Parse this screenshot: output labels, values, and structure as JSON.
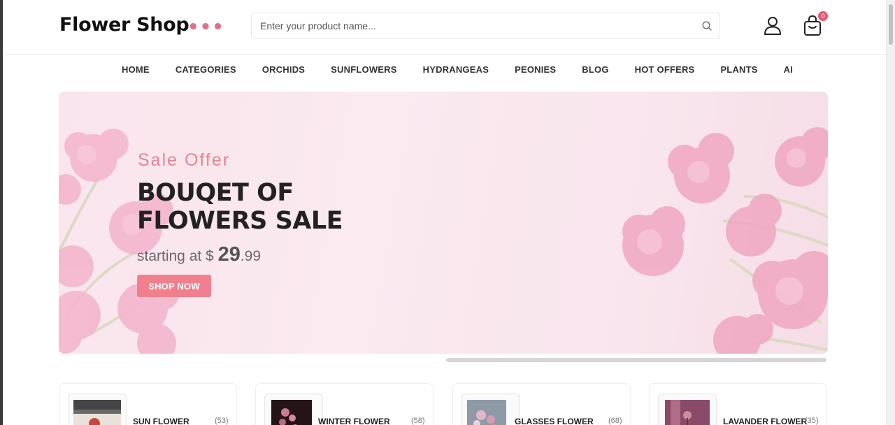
{
  "header": {
    "logo_text": "Flower Shop",
    "logo_dots": "•••",
    "search_placeholder": "Enter your product name...",
    "cart_count": "0",
    "icons": {
      "search": "search-icon",
      "user": "user-icon",
      "cart": "shopping-bag-icon"
    }
  },
  "nav": {
    "items": [
      "HOME",
      "CATEGORIES",
      "ORCHIDS",
      "SUNFLOWERS",
      "HYDRANGEAS",
      "PEONIES",
      "BLOG",
      "HOT OFFERS",
      "PLANTS",
      "AI"
    ]
  },
  "banner": {
    "subtitle": "Sale Offer",
    "headline_line1": "BOUQET OF",
    "headline_line2": "FLOWERS SALE",
    "price_prefix": "starting at $",
    "price_main": "29",
    "price_cents": ".99",
    "cta_label": "SHOP NOW"
  },
  "categories": [
    {
      "name": "SUN FLOWER",
      "count": "(53)"
    },
    {
      "name": "WINTER FLOWER",
      "count": "(58)"
    },
    {
      "name": "GLASSES FLOWER",
      "count": "(68)"
    },
    {
      "name": "LAVANDER FLOWER",
      "count": "(35)"
    }
  ],
  "colors": {
    "accent": "#f1808f",
    "logo_dots": "#e0708a",
    "banner_bg": "#f9e4ec",
    "badge": "#e65a6f"
  }
}
